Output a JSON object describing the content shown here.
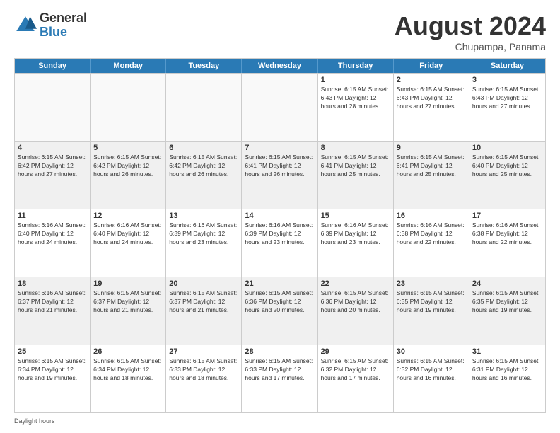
{
  "logo": {
    "general": "General",
    "blue": "Blue"
  },
  "title": "August 2024",
  "subtitle": "Chupampa, Panama",
  "days": [
    "Sunday",
    "Monday",
    "Tuesday",
    "Wednesday",
    "Thursday",
    "Friday",
    "Saturday"
  ],
  "footer": "Daylight hours",
  "weeks": [
    [
      {
        "day": "",
        "info": "",
        "empty": true
      },
      {
        "day": "",
        "info": "",
        "empty": true
      },
      {
        "day": "",
        "info": "",
        "empty": true
      },
      {
        "day": "",
        "info": "",
        "empty": true
      },
      {
        "day": "1",
        "info": "Sunrise: 6:15 AM\nSunset: 6:43 PM\nDaylight: 12 hours\nand 28 minutes."
      },
      {
        "day": "2",
        "info": "Sunrise: 6:15 AM\nSunset: 6:43 PM\nDaylight: 12 hours\nand 27 minutes."
      },
      {
        "day": "3",
        "info": "Sunrise: 6:15 AM\nSunset: 6:43 PM\nDaylight: 12 hours\nand 27 minutes."
      }
    ],
    [
      {
        "day": "4",
        "info": "Sunrise: 6:15 AM\nSunset: 6:42 PM\nDaylight: 12 hours\nand 27 minutes.",
        "shaded": true
      },
      {
        "day": "5",
        "info": "Sunrise: 6:15 AM\nSunset: 6:42 PM\nDaylight: 12 hours\nand 26 minutes.",
        "shaded": true
      },
      {
        "day": "6",
        "info": "Sunrise: 6:15 AM\nSunset: 6:42 PM\nDaylight: 12 hours\nand 26 minutes.",
        "shaded": true
      },
      {
        "day": "7",
        "info": "Sunrise: 6:15 AM\nSunset: 6:41 PM\nDaylight: 12 hours\nand 26 minutes.",
        "shaded": true
      },
      {
        "day": "8",
        "info": "Sunrise: 6:15 AM\nSunset: 6:41 PM\nDaylight: 12 hours\nand 25 minutes.",
        "shaded": true
      },
      {
        "day": "9",
        "info": "Sunrise: 6:15 AM\nSunset: 6:41 PM\nDaylight: 12 hours\nand 25 minutes.",
        "shaded": true
      },
      {
        "day": "10",
        "info": "Sunrise: 6:15 AM\nSunset: 6:40 PM\nDaylight: 12 hours\nand 25 minutes.",
        "shaded": true
      }
    ],
    [
      {
        "day": "11",
        "info": "Sunrise: 6:16 AM\nSunset: 6:40 PM\nDaylight: 12 hours\nand 24 minutes."
      },
      {
        "day": "12",
        "info": "Sunrise: 6:16 AM\nSunset: 6:40 PM\nDaylight: 12 hours\nand 24 minutes."
      },
      {
        "day": "13",
        "info": "Sunrise: 6:16 AM\nSunset: 6:39 PM\nDaylight: 12 hours\nand 23 minutes."
      },
      {
        "day": "14",
        "info": "Sunrise: 6:16 AM\nSunset: 6:39 PM\nDaylight: 12 hours\nand 23 minutes."
      },
      {
        "day": "15",
        "info": "Sunrise: 6:16 AM\nSunset: 6:39 PM\nDaylight: 12 hours\nand 23 minutes."
      },
      {
        "day": "16",
        "info": "Sunrise: 6:16 AM\nSunset: 6:38 PM\nDaylight: 12 hours\nand 22 minutes."
      },
      {
        "day": "17",
        "info": "Sunrise: 6:16 AM\nSunset: 6:38 PM\nDaylight: 12 hours\nand 22 minutes."
      }
    ],
    [
      {
        "day": "18",
        "info": "Sunrise: 6:16 AM\nSunset: 6:37 PM\nDaylight: 12 hours\nand 21 minutes.",
        "shaded": true
      },
      {
        "day": "19",
        "info": "Sunrise: 6:15 AM\nSunset: 6:37 PM\nDaylight: 12 hours\nand 21 minutes.",
        "shaded": true
      },
      {
        "day": "20",
        "info": "Sunrise: 6:15 AM\nSunset: 6:37 PM\nDaylight: 12 hours\nand 21 minutes.",
        "shaded": true
      },
      {
        "day": "21",
        "info": "Sunrise: 6:15 AM\nSunset: 6:36 PM\nDaylight: 12 hours\nand 20 minutes.",
        "shaded": true
      },
      {
        "day": "22",
        "info": "Sunrise: 6:15 AM\nSunset: 6:36 PM\nDaylight: 12 hours\nand 20 minutes.",
        "shaded": true
      },
      {
        "day": "23",
        "info": "Sunrise: 6:15 AM\nSunset: 6:35 PM\nDaylight: 12 hours\nand 19 minutes.",
        "shaded": true
      },
      {
        "day": "24",
        "info": "Sunrise: 6:15 AM\nSunset: 6:35 PM\nDaylight: 12 hours\nand 19 minutes.",
        "shaded": true
      }
    ],
    [
      {
        "day": "25",
        "info": "Sunrise: 6:15 AM\nSunset: 6:34 PM\nDaylight: 12 hours\nand 19 minutes."
      },
      {
        "day": "26",
        "info": "Sunrise: 6:15 AM\nSunset: 6:34 PM\nDaylight: 12 hours\nand 18 minutes."
      },
      {
        "day": "27",
        "info": "Sunrise: 6:15 AM\nSunset: 6:33 PM\nDaylight: 12 hours\nand 18 minutes."
      },
      {
        "day": "28",
        "info": "Sunrise: 6:15 AM\nSunset: 6:33 PM\nDaylight: 12 hours\nand 17 minutes."
      },
      {
        "day": "29",
        "info": "Sunrise: 6:15 AM\nSunset: 6:32 PM\nDaylight: 12 hours\nand 17 minutes."
      },
      {
        "day": "30",
        "info": "Sunrise: 6:15 AM\nSunset: 6:32 PM\nDaylight: 12 hours\nand 16 minutes."
      },
      {
        "day": "31",
        "info": "Sunrise: 6:15 AM\nSunset: 6:31 PM\nDaylight: 12 hours\nand 16 minutes."
      }
    ]
  ]
}
